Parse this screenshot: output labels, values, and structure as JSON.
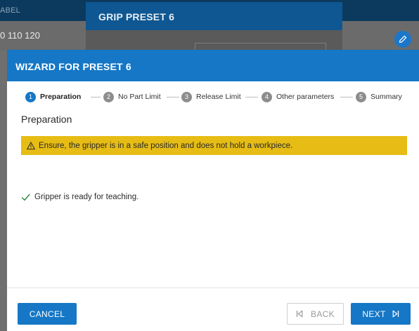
{
  "background_app": {
    "header_label": "ABEL",
    "row_value": "0 110 120",
    "edit_icon": "pencil-icon"
  },
  "grip_dialog": {
    "title": "GRIP PRESET 6"
  },
  "wizard": {
    "title": "WIZARD FOR PRESET 6",
    "steps": [
      {
        "number": "1",
        "label": "Preparation",
        "active": true
      },
      {
        "number": "2",
        "label": "No Part Limit",
        "active": false
      },
      {
        "number": "3",
        "label": "Release Limit",
        "active": false
      },
      {
        "number": "4",
        "label": "Other parameters",
        "active": false
      },
      {
        "number": "5",
        "label": "Summary",
        "active": false
      }
    ],
    "section_title": "Preparation",
    "warning": {
      "icon": "warning-triangle-icon",
      "text": "Ensure, the gripper is in a safe position and does not hold a workpiece."
    },
    "status": {
      "icon": "checkmark-icon",
      "text": "Gripper is ready for teaching."
    },
    "buttons": {
      "cancel": "CANCEL",
      "back": "BACK",
      "back_icon": "skip-back-icon",
      "next": "NEXT",
      "next_icon": "skip-forward-icon"
    }
  },
  "colors": {
    "primary_blue": "#1577c6",
    "dark_blue": "#0b3a5e",
    "warning_yellow": "#e6bc15",
    "success_green": "#2e8b3d",
    "inactive_step": "#8d8d8d"
  }
}
